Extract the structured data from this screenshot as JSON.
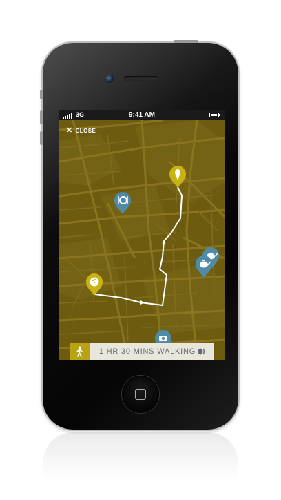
{
  "status_bar": {
    "network": "3G",
    "time": "9:41 AM",
    "battery_level": 0.85,
    "signal_bars": 5
  },
  "header": {
    "close_label": "CLOSE",
    "close_icon": "close-icon"
  },
  "map": {
    "background_color": "#6d5c10",
    "route_color": "#ffffff",
    "markers": [
      {
        "name": "start-marker",
        "icon": "bowling-ball-icon",
        "color": "#c9b214"
      },
      {
        "name": "ice-cream-marker",
        "icon": "ice-cream-icon",
        "color": "#c9b214"
      },
      {
        "name": "restaurant-marker",
        "icon": "plate-cutlery-icon",
        "color": "#4f8ba6"
      },
      {
        "name": "teapot-marker",
        "icon": "teapot-icon",
        "color": "#4f8ba6"
      },
      {
        "name": "camera-marker",
        "icon": "camera-icon",
        "color": "#4f8ba6"
      }
    ]
  },
  "walk_bar": {
    "label": "1 HR 30 MINS WALKING",
    "walk_icon": "walking-person-icon",
    "sound_icon": "sound-icon",
    "accent_color": "#b9a313"
  }
}
